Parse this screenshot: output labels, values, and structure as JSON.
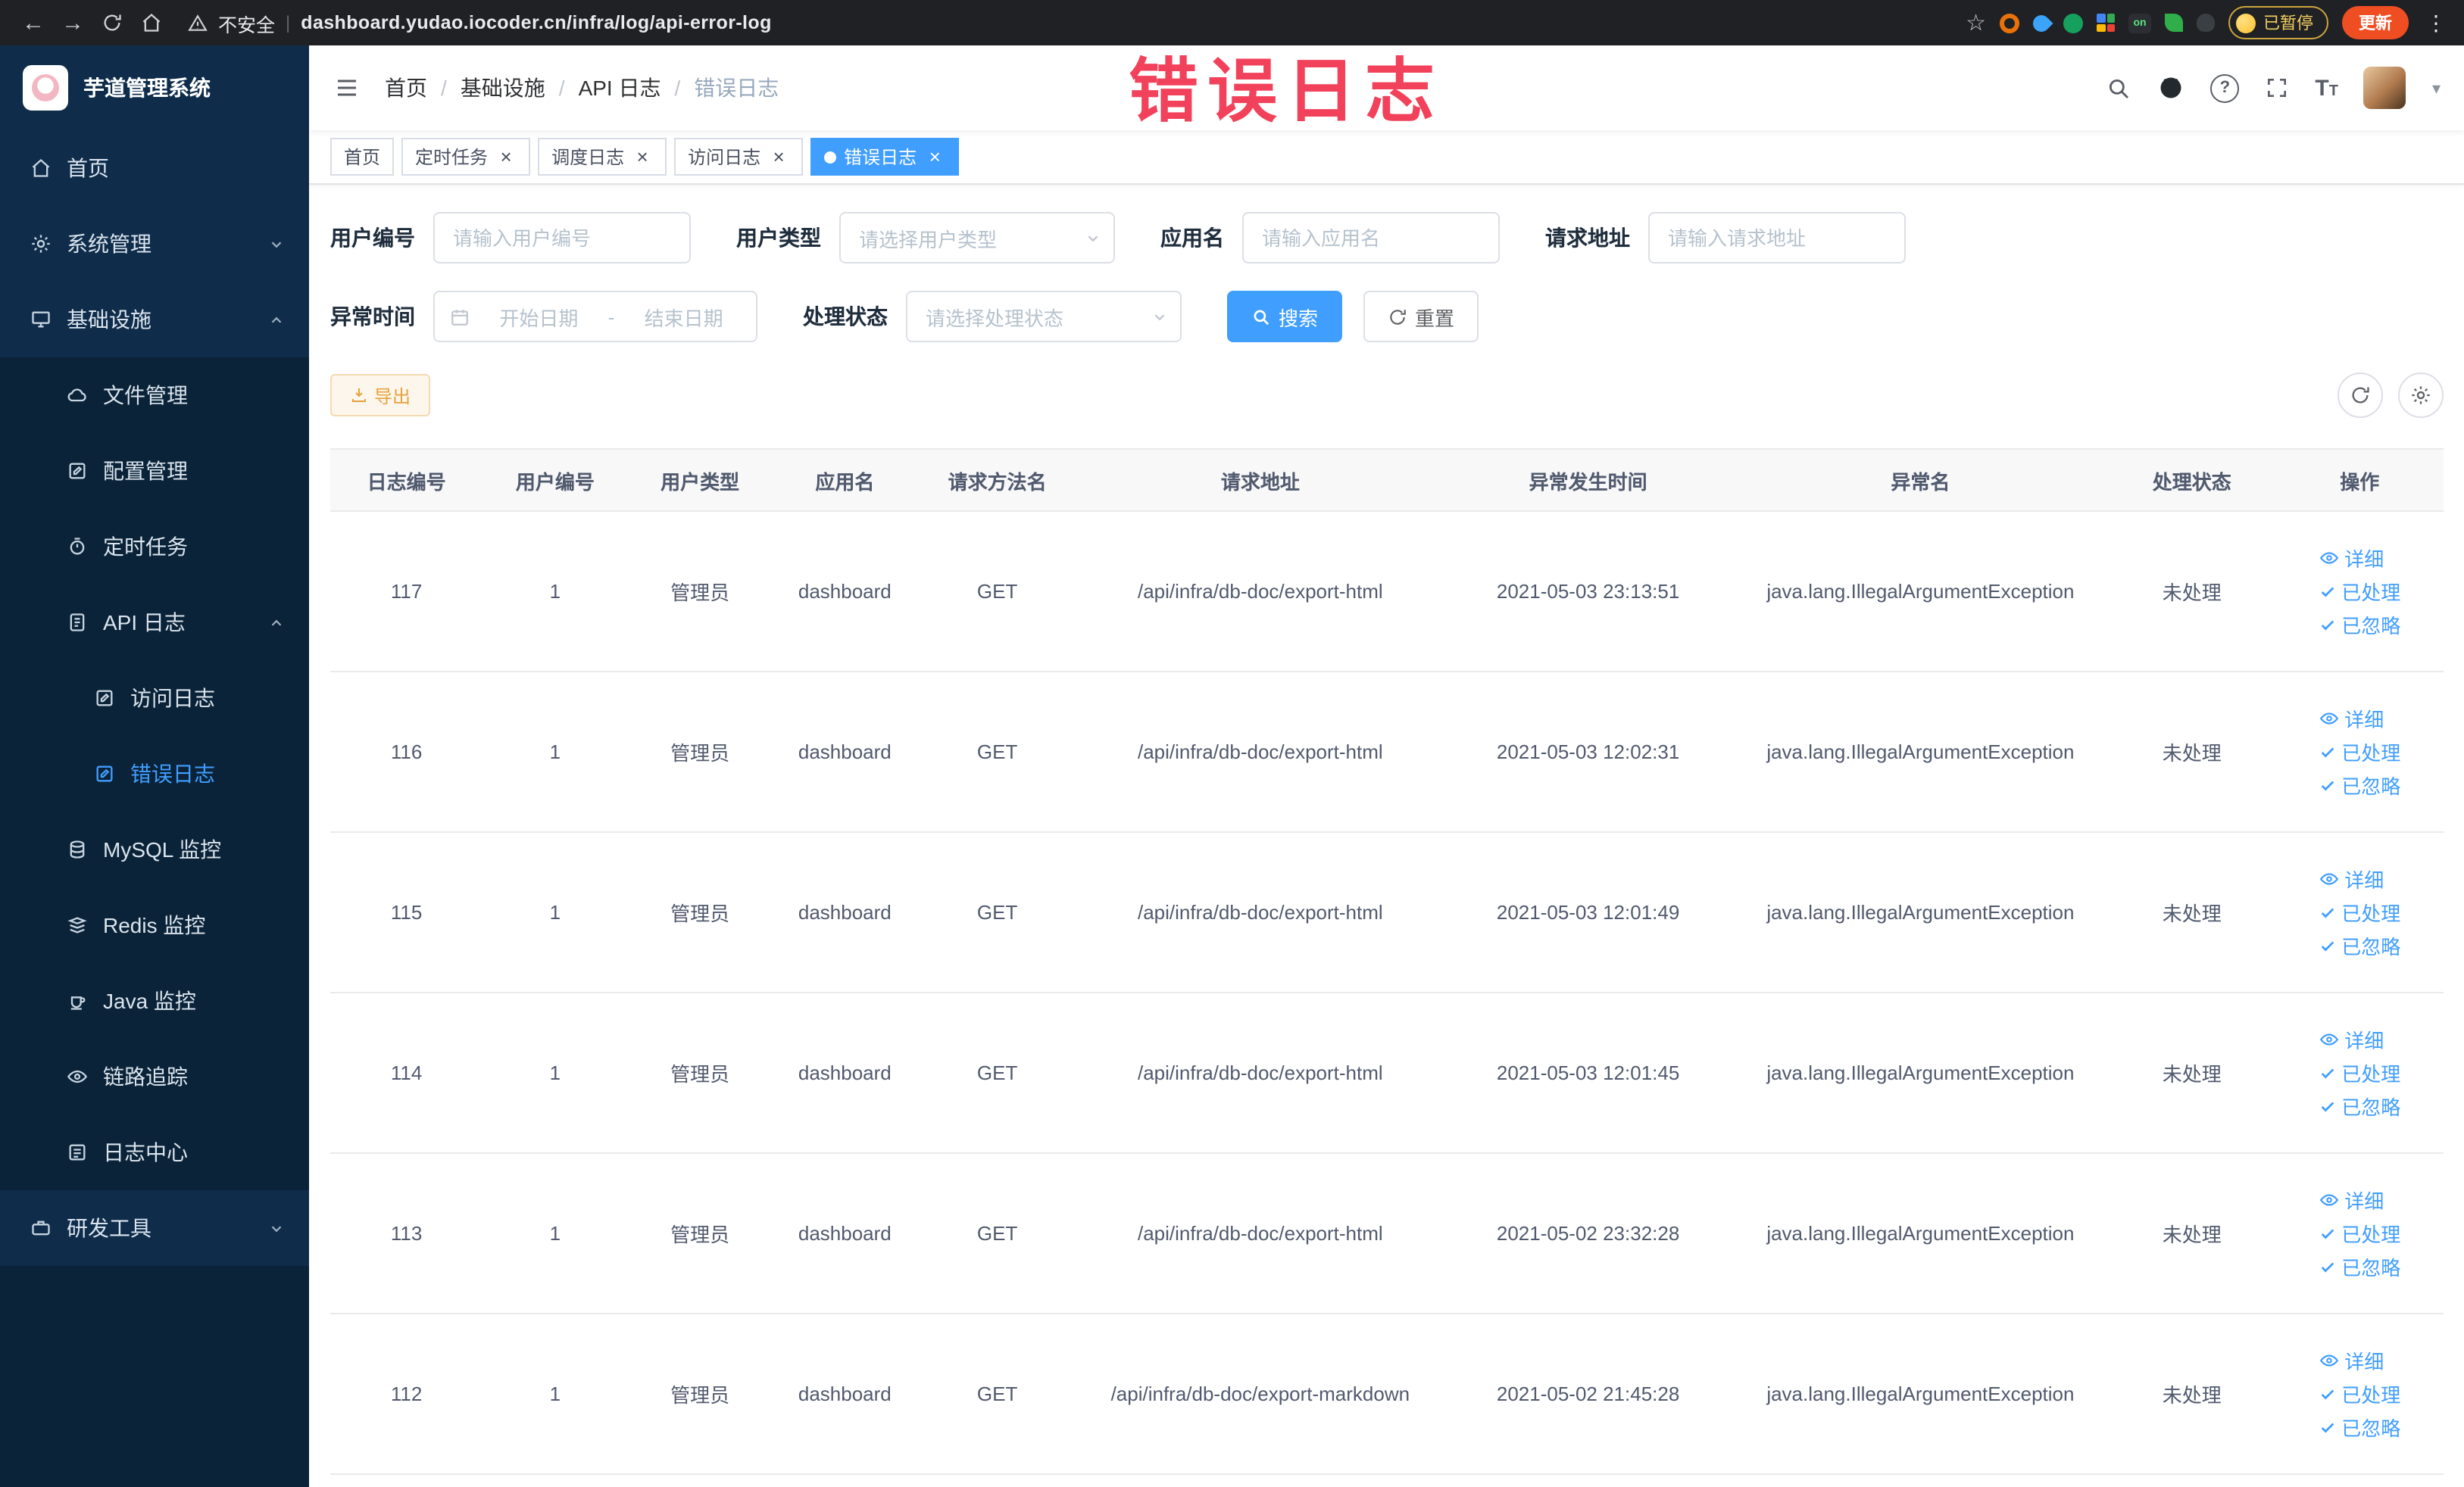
{
  "colors": {
    "accent": "#409eff",
    "watermark_red": "#f2415a",
    "warning": "#e6a23c",
    "sidebar_bg": "#0a2338",
    "sidebar_item_bg": "#0f2d4b"
  },
  "browser": {
    "security_label": "不安全",
    "url": "dashboard.yudao.iocoder.cn/infra/log/api-error-log",
    "extension_on_label": "on",
    "paused_badge": "已暂停",
    "update_button": "更新"
  },
  "overlay": {
    "watermark": "错误日志"
  },
  "sidebar": {
    "logo_title": "芋道管理系统",
    "items": [
      {
        "label": "首页"
      },
      {
        "label": "系统管理"
      },
      {
        "label": "基础设施"
      },
      {
        "label": "文件管理"
      },
      {
        "label": "配置管理"
      },
      {
        "label": "定时任务"
      },
      {
        "label": "API 日志"
      },
      {
        "label": "访问日志"
      },
      {
        "label": "错误日志"
      },
      {
        "label": "MySQL 监控"
      },
      {
        "label": "Redis 监控"
      },
      {
        "label": "Java 监控"
      },
      {
        "label": "链路追踪"
      },
      {
        "label": "日志中心"
      },
      {
        "label": "研发工具"
      }
    ]
  },
  "breadcrumb": {
    "separator": "/",
    "items": [
      "首页",
      "基础设施",
      "API 日志",
      "错误日志"
    ]
  },
  "tabs": [
    {
      "label": "首页"
    },
    {
      "label": "定时任务"
    },
    {
      "label": "调度日志"
    },
    {
      "label": "访问日志"
    },
    {
      "label": "错误日志"
    }
  ],
  "filters": {
    "user_id": {
      "label": "用户编号",
      "placeholder": "请输入用户编号"
    },
    "user_type": {
      "label": "用户类型",
      "placeholder": "请选择用户类型"
    },
    "app_name": {
      "label": "应用名",
      "placeholder": "请输入应用名"
    },
    "request_url": {
      "label": "请求地址",
      "placeholder": "请输入请求地址"
    },
    "exception_time": {
      "label": "异常时间",
      "start_placeholder": "开始日期",
      "separator": "-",
      "end_placeholder": "结束日期"
    },
    "process_status": {
      "label": "处理状态",
      "placeholder": "请选择处理状态"
    },
    "search_label": "搜索",
    "reset_label": "重置"
  },
  "toolbar": {
    "export_label": "导出"
  },
  "table": {
    "headers": [
      "日志编号",
      "用户编号",
      "用户类型",
      "应用名",
      "请求方法名",
      "请求地址",
      "异常发生时间",
      "异常名",
      "处理状态",
      "操作"
    ],
    "row_actions": {
      "detail": "详细",
      "processed": "已处理",
      "ignored": "已忽略"
    },
    "rows": [
      {
        "id": "117",
        "user_id": "1",
        "user_type": "管理员",
        "app": "dashboard",
        "method": "GET",
        "url": "/api/infra/db-doc/export-html",
        "time": "2021-05-03 23:13:51",
        "exception": "java.lang.IllegalArgumentException",
        "status": "未处理"
      },
      {
        "id": "116",
        "user_id": "1",
        "user_type": "管理员",
        "app": "dashboard",
        "method": "GET",
        "url": "/api/infra/db-doc/export-html",
        "time": "2021-05-03 12:02:31",
        "exception": "java.lang.IllegalArgumentException",
        "status": "未处理"
      },
      {
        "id": "115",
        "user_id": "1",
        "user_type": "管理员",
        "app": "dashboard",
        "method": "GET",
        "url": "/api/infra/db-doc/export-html",
        "time": "2021-05-03 12:01:49",
        "exception": "java.lang.IllegalArgumentException",
        "status": "未处理"
      },
      {
        "id": "114",
        "user_id": "1",
        "user_type": "管理员",
        "app": "dashboard",
        "method": "GET",
        "url": "/api/infra/db-doc/export-html",
        "time": "2021-05-03 12:01:45",
        "exception": "java.lang.IllegalArgumentException",
        "status": "未处理"
      },
      {
        "id": "113",
        "user_id": "1",
        "user_type": "管理员",
        "app": "dashboard",
        "method": "GET",
        "url": "/api/infra/db-doc/export-html",
        "time": "2021-05-02 23:32:28",
        "exception": "java.lang.IllegalArgumentException",
        "status": "未处理"
      },
      {
        "id": "112",
        "user_id": "1",
        "user_type": "管理员",
        "app": "dashboard",
        "method": "GET",
        "url": "/api/infra/db-doc/export-markdown",
        "time": "2021-05-02 21:45:28",
        "exception": "java.lang.IllegalArgumentException",
        "status": "未处理"
      }
    ]
  }
}
